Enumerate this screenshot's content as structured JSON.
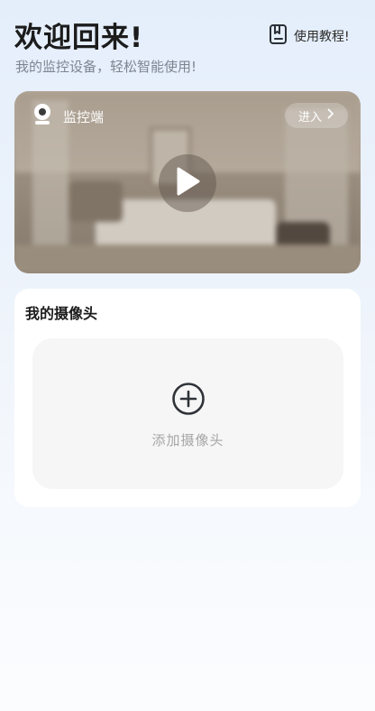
{
  "header": {
    "title": "欢迎回来!",
    "subtitle": "我的监控设备，轻松智能使用!",
    "tutorial_label": "使用教程!"
  },
  "monitor": {
    "label": "监控端",
    "enter_label": "进入"
  },
  "cameras": {
    "section_title": "我的摄像头",
    "add_label": "添加摄像头"
  }
}
